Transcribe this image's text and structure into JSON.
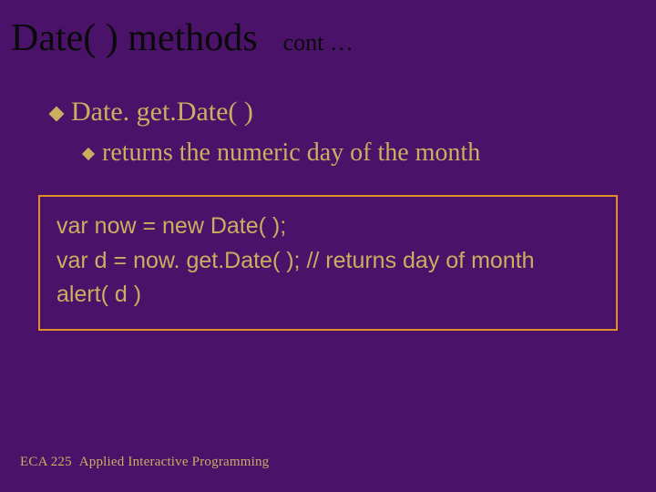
{
  "header": {
    "title": "Date( ) methods",
    "cont": "cont …"
  },
  "bullets": {
    "level1": "Date. get.Date( )",
    "level2": "returns the numeric day of the month"
  },
  "code": {
    "line1": "var now = new Date( );",
    "line2": "var d = now. get.Date( ); // returns day of month",
    "line3": "alert( d )"
  },
  "footer": {
    "course": "ECA 225",
    "courseTitle": "Applied Interactive Programming"
  }
}
